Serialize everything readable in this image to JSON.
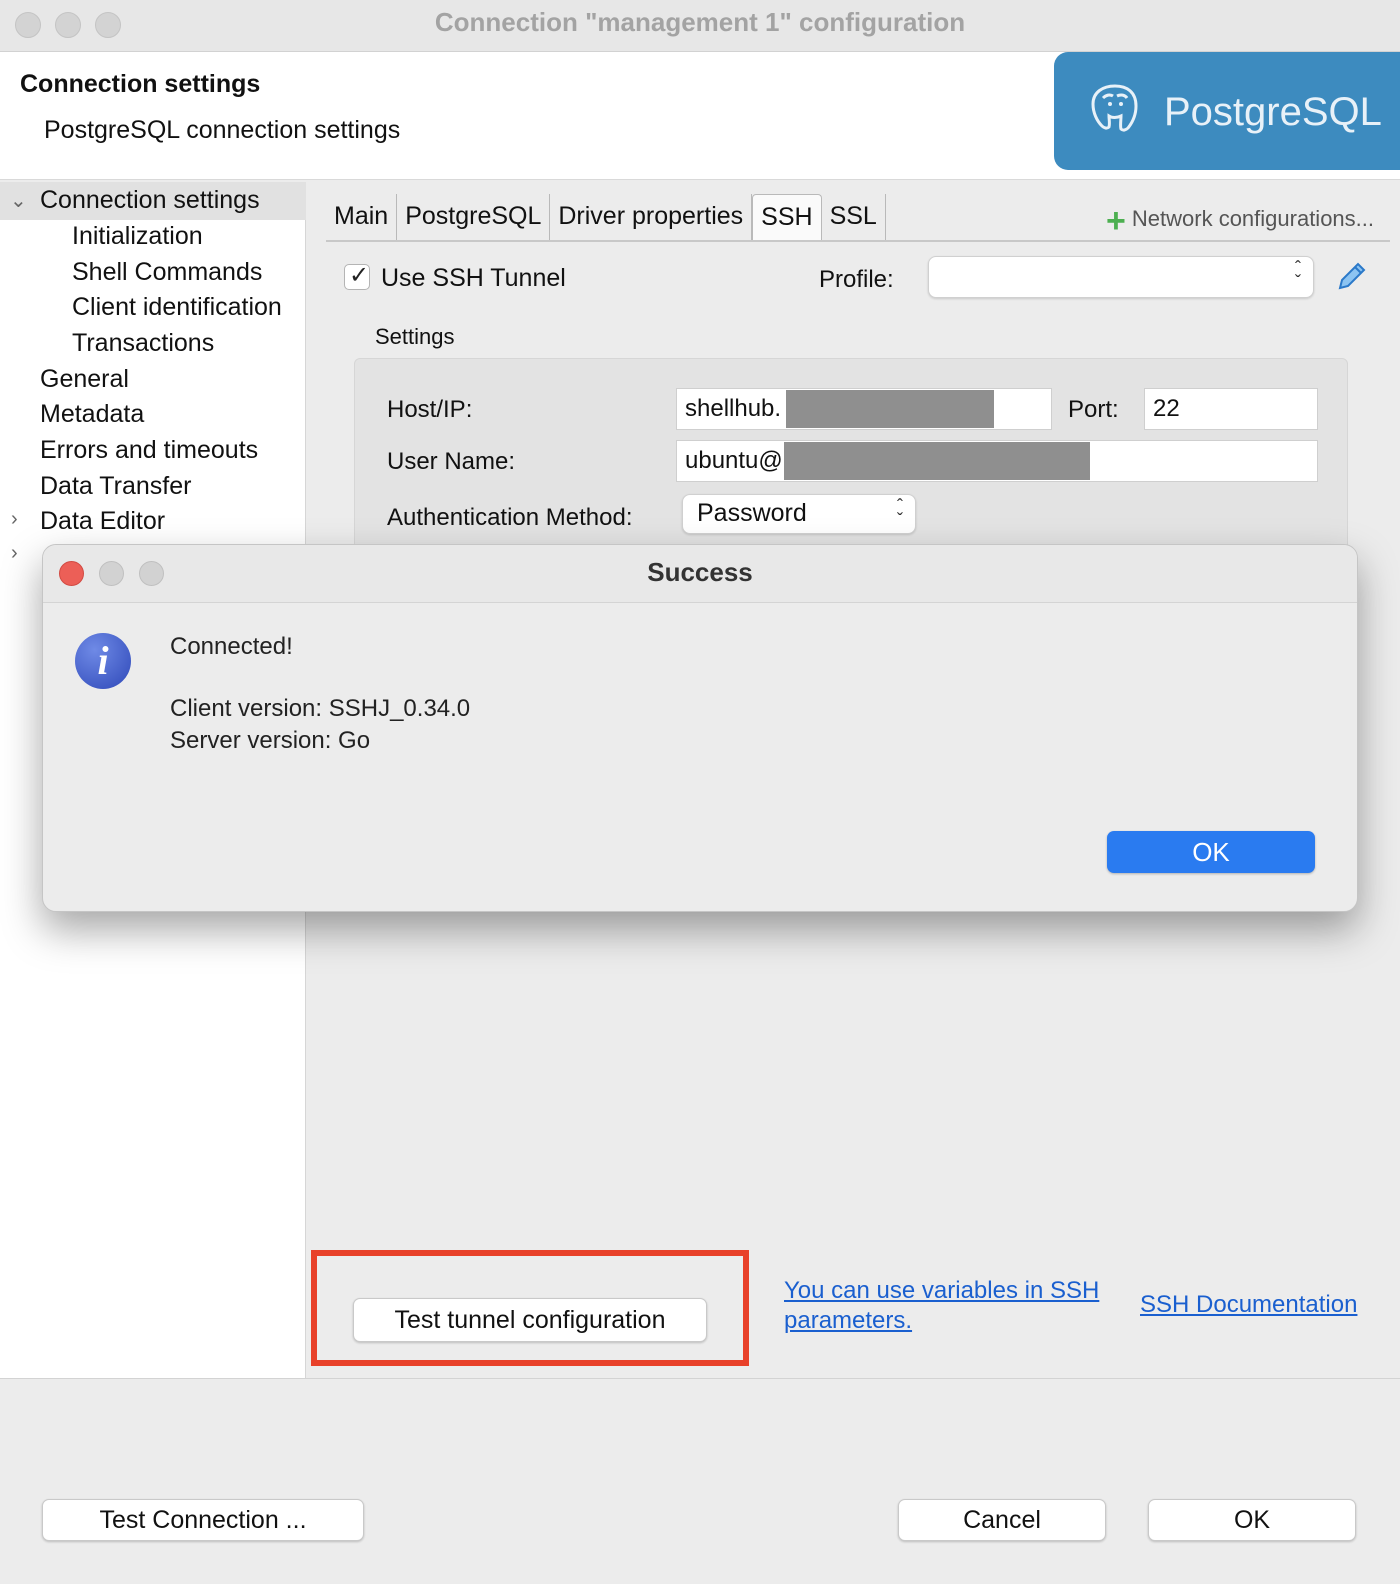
{
  "window": {
    "title": "Connection \"management 1\" configuration"
  },
  "header": {
    "title": "Connection settings",
    "subtitle": "PostgreSQL connection settings",
    "logo_text": "PostgreSQL"
  },
  "tree": {
    "items": [
      {
        "label": "Connection settings"
      },
      {
        "label": "Initialization"
      },
      {
        "label": "Shell Commands"
      },
      {
        "label": "Client identification"
      },
      {
        "label": "Transactions"
      },
      {
        "label": "General"
      },
      {
        "label": "Metadata"
      },
      {
        "label": "Errors and timeouts"
      },
      {
        "label": "Data Transfer"
      },
      {
        "label": "Data Editor"
      }
    ]
  },
  "tabs": [
    {
      "label": "Main"
    },
    {
      "label": "PostgreSQL"
    },
    {
      "label": "Driver properties"
    },
    {
      "label": "SSH"
    },
    {
      "label": "SSL"
    }
  ],
  "network_configurations": "Network configurations...",
  "ssh": {
    "use_tunnel_label": "Use SSH Tunnel",
    "use_tunnel_checked": true,
    "profile_label": "Profile:",
    "profile_value": "",
    "settings_label": "Settings",
    "host_label": "Host/IP:",
    "host_value": "shellhub.",
    "port_label": "Port:",
    "port_value": "22",
    "user_label": "User Name:",
    "user_value": "ubuntu@",
    "auth_label": "Authentication Method:",
    "auth_value": "Password",
    "test_tunnel_button": "Test tunnel configuration",
    "variables_link_1": "You can use variables in SSH",
    "variables_link_2": "parameters.",
    "docs_link": "SSH Documentation"
  },
  "footer": {
    "test_connection": "Test Connection ...",
    "cancel": "Cancel",
    "ok": "OK"
  },
  "dialog": {
    "title": "Success",
    "message": "Connected!",
    "client_version": "Client version: SSHJ_0.34.0",
    "server_version": "Server version: Go",
    "ok": "OK"
  },
  "colors": {
    "postgres_blue": "#3d8bbf",
    "link_blue": "#1a5fcf",
    "highlight_red": "#e8412a",
    "primary_button": "#2a7bf0"
  }
}
